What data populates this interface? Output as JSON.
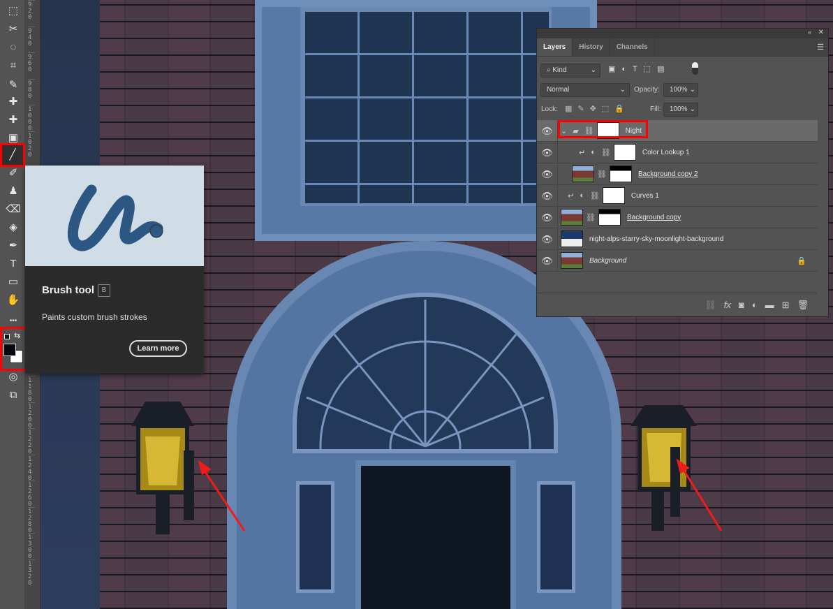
{
  "toolbar": {
    "tools": [
      {
        "name": "rectangular-marquee",
        "glyph": "⬚"
      },
      {
        "name": "lasso",
        "glyph": "✂"
      },
      {
        "name": "quick-selection",
        "glyph": "◌"
      },
      {
        "name": "crop",
        "glyph": "⌗"
      },
      {
        "name": "eyedropper",
        "glyph": "✎"
      },
      {
        "name": "spot-healing",
        "glyph": "✚"
      },
      {
        "name": "healing-brush",
        "glyph": "✚"
      },
      {
        "name": "patch",
        "glyph": "▣"
      },
      {
        "name": "brush",
        "glyph": "╱"
      },
      {
        "name": "mixer-brush",
        "glyph": "✐"
      },
      {
        "name": "clone-stamp",
        "glyph": "♟"
      },
      {
        "name": "eraser",
        "glyph": "⌫"
      },
      {
        "name": "paint-bucket",
        "glyph": "◈"
      },
      {
        "name": "pen",
        "glyph": "✒"
      },
      {
        "name": "type",
        "glyph": "T"
      },
      {
        "name": "rectangle",
        "glyph": "▭"
      },
      {
        "name": "hand",
        "glyph": "✋"
      },
      {
        "name": "more",
        "glyph": "•••"
      }
    ],
    "foreground_color": "#05080f",
    "background_color": "#ffffff"
  },
  "ruler": {
    "labels_top": [
      "920",
      "940",
      "960",
      "980",
      "1000",
      "1020"
    ],
    "labels_bottom": [
      "1180",
      "1200",
      "1220",
      "1240",
      "1260",
      "1280",
      "1300",
      "1320"
    ]
  },
  "tooltip": {
    "title": "Brush tool",
    "shortcut": "B",
    "description": "Paints custom brush strokes",
    "button": "Learn more"
  },
  "layers_panel": {
    "tabs": [
      "Layers",
      "History",
      "Channels"
    ],
    "filter": "Kind",
    "blend_mode": "Normal",
    "opacity_label": "Opacity:",
    "opacity": "100%",
    "lock_label": "Lock:",
    "fill_label": "Fill:",
    "fill": "100%",
    "layers": [
      {
        "name": "Night",
        "type": "group"
      },
      {
        "name": "Color Lookup 1",
        "type": "adjustment"
      },
      {
        "name": "Background copy 2",
        "type": "pixel"
      },
      {
        "name": "Curves 1",
        "type": "adjustment"
      },
      {
        "name": "Background copy",
        "type": "pixel"
      },
      {
        "name": "night-alps-starry-sky-moonlight-background",
        "type": "smart"
      },
      {
        "name": "Background",
        "type": "background"
      }
    ]
  },
  "colors": {
    "highlight": "#ff0000",
    "panel": "#535353"
  }
}
